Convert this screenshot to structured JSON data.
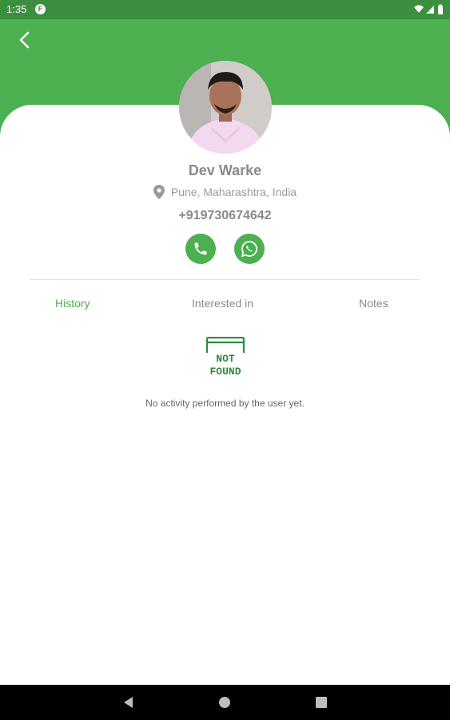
{
  "status_bar": {
    "time": "1:35",
    "app_icon_letter": "F"
  },
  "profile": {
    "name": "Dev Warke",
    "location": "Pune, Maharashtra, India",
    "phone": "+919730674642"
  },
  "tabs": [
    {
      "label": "History",
      "active": true
    },
    {
      "label": "Interested in",
      "active": false
    },
    {
      "label": "Notes",
      "active": false
    }
  ],
  "empty_state": {
    "icon_line1": "NOT",
    "icon_line2": "FOUND",
    "message": "No activity performed by the user yet."
  },
  "colors": {
    "primary": "#4caf50",
    "status_bar": "#3b8f3e",
    "text_gray": "#8a8a8a"
  },
  "icons": [
    "back-arrow-icon",
    "location-pin-icon",
    "phone-icon",
    "whatsapp-icon",
    "not-found-icon"
  ]
}
